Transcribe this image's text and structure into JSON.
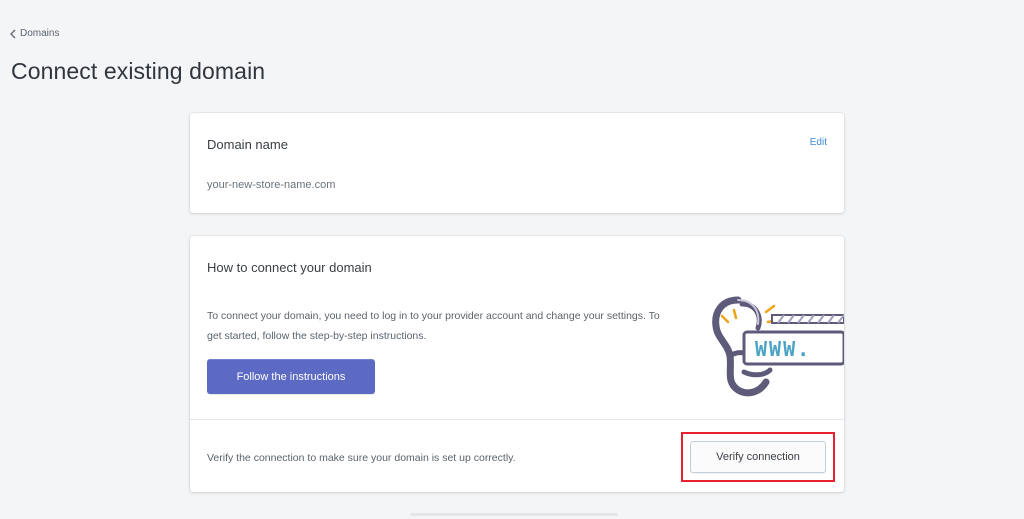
{
  "breadcrumb": {
    "label": "Domains"
  },
  "page_title": "Connect existing domain",
  "domain_card": {
    "label": "Domain name",
    "edit_label": "Edit",
    "value": "your-new-store-name.com"
  },
  "connect_card": {
    "heading": "How to connect your domain",
    "description": "To connect your domain, you need to log in to your provider account and change your settings. To get started, follow the step-by-step instructions.",
    "follow_button": "Follow the instructions",
    "illustration_text": "WWW.",
    "verify_text": "Verify the connection to make sure your domain is set up correctly.",
    "verify_button": "Verify connection"
  },
  "colors": {
    "background": "#f4f5f6",
    "primary_button": "#5c6ac4",
    "link": "#3f8ad2",
    "highlight": "#e8212e",
    "illustration_dark": "#5d5a7a",
    "illustration_accent": "#4aa3c3",
    "illustration_spark": "#f0a318"
  },
  "icons": {
    "breadcrumb": "chevron-left-icon",
    "illustration": "www-link-illustration"
  }
}
